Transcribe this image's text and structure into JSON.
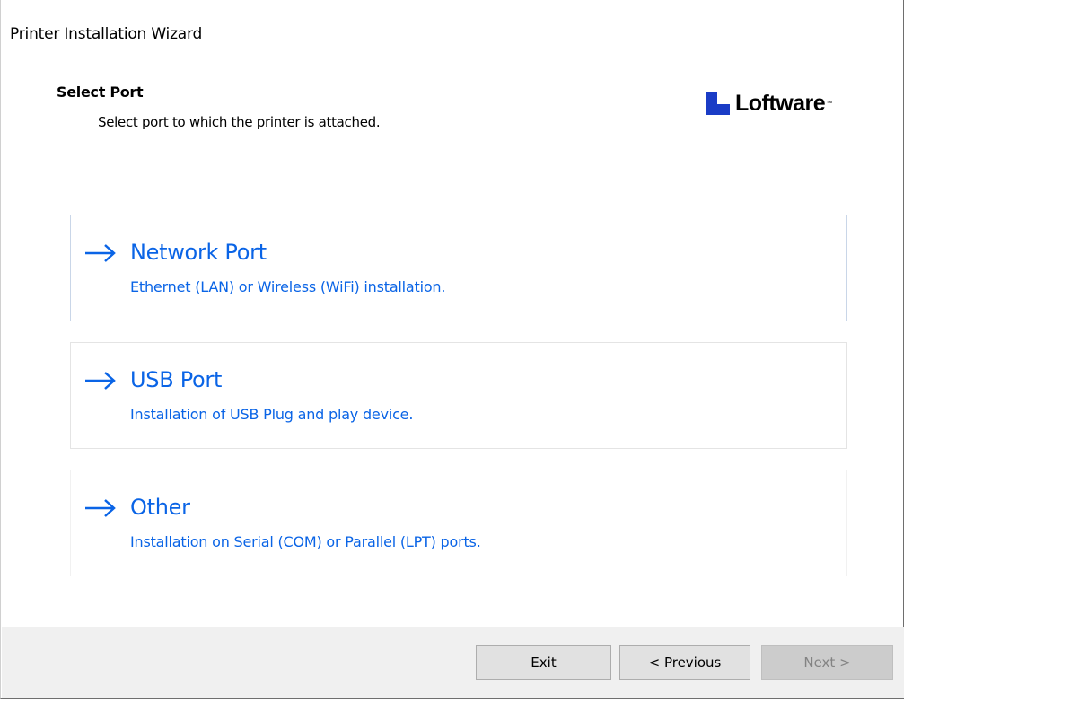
{
  "window": {
    "title": "Printer Installation Wizard"
  },
  "header": {
    "heading": "Select Port",
    "subheading": "Select port to which the printer is attached.",
    "logo_text": "Loftware",
    "logo_mark": "™"
  },
  "options": [
    {
      "title": "Network Port",
      "description": "Ethernet (LAN) or Wireless (WiFi) installation.",
      "icon": "arrow-right-icon"
    },
    {
      "title": "USB Port",
      "description": "Installation of USB Plug and play device.",
      "icon": "arrow-right-icon"
    },
    {
      "title": "Other",
      "description": "Installation on Serial (COM) or Parallel (LPT) ports.",
      "icon": "arrow-right-icon"
    }
  ],
  "footer": {
    "exit_label": "Exit",
    "previous_label": "< Previous",
    "next_label": "Next >"
  },
  "colors": {
    "link_blue": "#0a64e6",
    "logo_blue": "#1a3cc6",
    "footer_bg": "#f0f0f0"
  }
}
